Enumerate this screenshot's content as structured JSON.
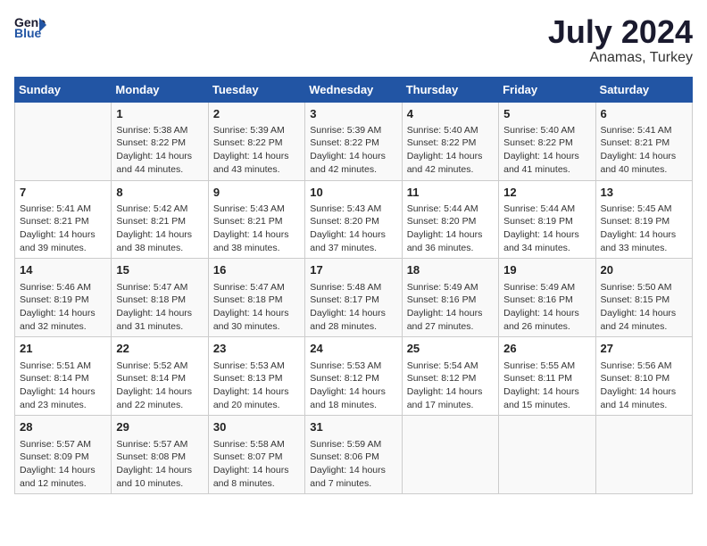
{
  "header": {
    "logo_line1": "General",
    "logo_line2": "Blue",
    "month": "July 2024",
    "location": "Anamas, Turkey"
  },
  "weekdays": [
    "Sunday",
    "Monday",
    "Tuesday",
    "Wednesday",
    "Thursday",
    "Friday",
    "Saturday"
  ],
  "weeks": [
    [
      {
        "day": "",
        "info": ""
      },
      {
        "day": "1",
        "info": "Sunrise: 5:38 AM\nSunset: 8:22 PM\nDaylight: 14 hours\nand 44 minutes."
      },
      {
        "day": "2",
        "info": "Sunrise: 5:39 AM\nSunset: 8:22 PM\nDaylight: 14 hours\nand 43 minutes."
      },
      {
        "day": "3",
        "info": "Sunrise: 5:39 AM\nSunset: 8:22 PM\nDaylight: 14 hours\nand 42 minutes."
      },
      {
        "day": "4",
        "info": "Sunrise: 5:40 AM\nSunset: 8:22 PM\nDaylight: 14 hours\nand 42 minutes."
      },
      {
        "day": "5",
        "info": "Sunrise: 5:40 AM\nSunset: 8:22 PM\nDaylight: 14 hours\nand 41 minutes."
      },
      {
        "day": "6",
        "info": "Sunrise: 5:41 AM\nSunset: 8:21 PM\nDaylight: 14 hours\nand 40 minutes."
      }
    ],
    [
      {
        "day": "7",
        "info": "Sunrise: 5:41 AM\nSunset: 8:21 PM\nDaylight: 14 hours\nand 39 minutes."
      },
      {
        "day": "8",
        "info": "Sunrise: 5:42 AM\nSunset: 8:21 PM\nDaylight: 14 hours\nand 38 minutes."
      },
      {
        "day": "9",
        "info": "Sunrise: 5:43 AM\nSunset: 8:21 PM\nDaylight: 14 hours\nand 38 minutes."
      },
      {
        "day": "10",
        "info": "Sunrise: 5:43 AM\nSunset: 8:20 PM\nDaylight: 14 hours\nand 37 minutes."
      },
      {
        "day": "11",
        "info": "Sunrise: 5:44 AM\nSunset: 8:20 PM\nDaylight: 14 hours\nand 36 minutes."
      },
      {
        "day": "12",
        "info": "Sunrise: 5:44 AM\nSunset: 8:19 PM\nDaylight: 14 hours\nand 34 minutes."
      },
      {
        "day": "13",
        "info": "Sunrise: 5:45 AM\nSunset: 8:19 PM\nDaylight: 14 hours\nand 33 minutes."
      }
    ],
    [
      {
        "day": "14",
        "info": "Sunrise: 5:46 AM\nSunset: 8:19 PM\nDaylight: 14 hours\nand 32 minutes."
      },
      {
        "day": "15",
        "info": "Sunrise: 5:47 AM\nSunset: 8:18 PM\nDaylight: 14 hours\nand 31 minutes."
      },
      {
        "day": "16",
        "info": "Sunrise: 5:47 AM\nSunset: 8:18 PM\nDaylight: 14 hours\nand 30 minutes."
      },
      {
        "day": "17",
        "info": "Sunrise: 5:48 AM\nSunset: 8:17 PM\nDaylight: 14 hours\nand 28 minutes."
      },
      {
        "day": "18",
        "info": "Sunrise: 5:49 AM\nSunset: 8:16 PM\nDaylight: 14 hours\nand 27 minutes."
      },
      {
        "day": "19",
        "info": "Sunrise: 5:49 AM\nSunset: 8:16 PM\nDaylight: 14 hours\nand 26 minutes."
      },
      {
        "day": "20",
        "info": "Sunrise: 5:50 AM\nSunset: 8:15 PM\nDaylight: 14 hours\nand 24 minutes."
      }
    ],
    [
      {
        "day": "21",
        "info": "Sunrise: 5:51 AM\nSunset: 8:14 PM\nDaylight: 14 hours\nand 23 minutes."
      },
      {
        "day": "22",
        "info": "Sunrise: 5:52 AM\nSunset: 8:14 PM\nDaylight: 14 hours\nand 22 minutes."
      },
      {
        "day": "23",
        "info": "Sunrise: 5:53 AM\nSunset: 8:13 PM\nDaylight: 14 hours\nand 20 minutes."
      },
      {
        "day": "24",
        "info": "Sunrise: 5:53 AM\nSunset: 8:12 PM\nDaylight: 14 hours\nand 18 minutes."
      },
      {
        "day": "25",
        "info": "Sunrise: 5:54 AM\nSunset: 8:12 PM\nDaylight: 14 hours\nand 17 minutes."
      },
      {
        "day": "26",
        "info": "Sunrise: 5:55 AM\nSunset: 8:11 PM\nDaylight: 14 hours\nand 15 minutes."
      },
      {
        "day": "27",
        "info": "Sunrise: 5:56 AM\nSunset: 8:10 PM\nDaylight: 14 hours\nand 14 minutes."
      }
    ],
    [
      {
        "day": "28",
        "info": "Sunrise: 5:57 AM\nSunset: 8:09 PM\nDaylight: 14 hours\nand 12 minutes."
      },
      {
        "day": "29",
        "info": "Sunrise: 5:57 AM\nSunset: 8:08 PM\nDaylight: 14 hours\nand 10 minutes."
      },
      {
        "day": "30",
        "info": "Sunrise: 5:58 AM\nSunset: 8:07 PM\nDaylight: 14 hours\nand 8 minutes."
      },
      {
        "day": "31",
        "info": "Sunrise: 5:59 AM\nSunset: 8:06 PM\nDaylight: 14 hours\nand 7 minutes."
      },
      {
        "day": "",
        "info": ""
      },
      {
        "day": "",
        "info": ""
      },
      {
        "day": "",
        "info": ""
      }
    ]
  ]
}
